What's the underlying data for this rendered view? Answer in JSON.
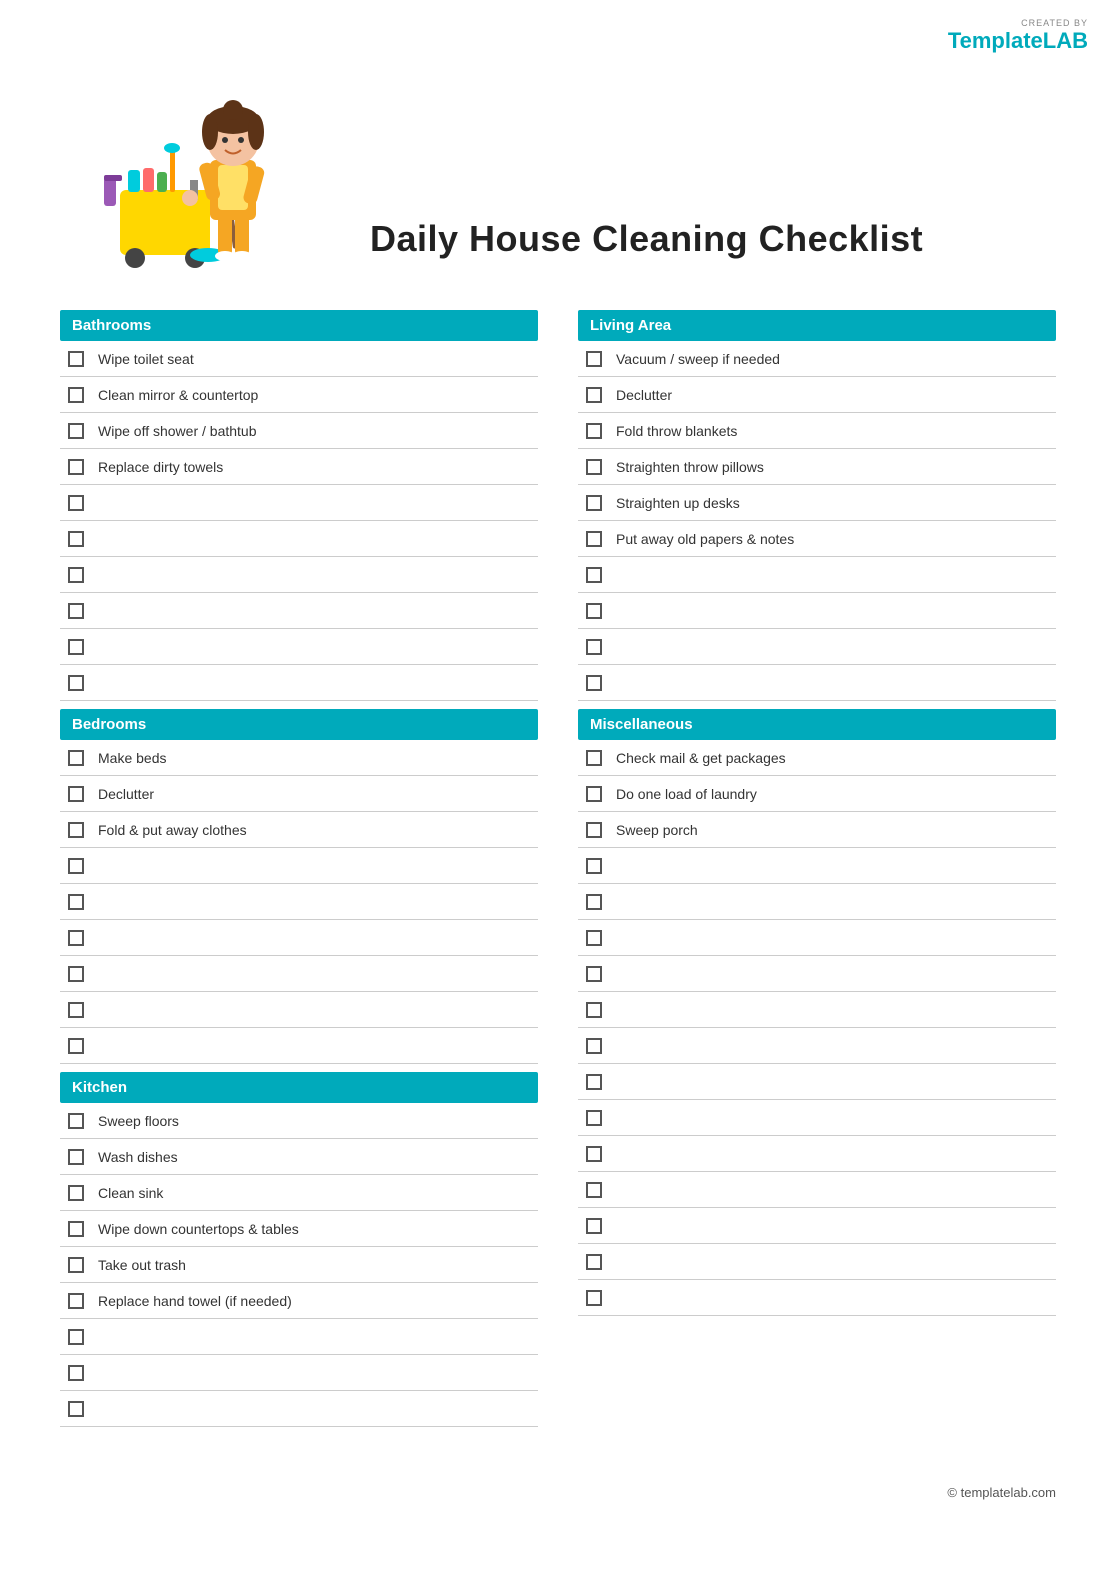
{
  "logo": {
    "created_by": "CREATED BY",
    "template": "Template",
    "lab": "LAB"
  },
  "title": "Daily House Cleaning Checklist",
  "sections": {
    "bathrooms": {
      "label": "Bathrooms",
      "items": [
        "Wipe toilet seat",
        "Clean mirror & countertop",
        "Wipe off shower / bathtub",
        "Replace dirty towels",
        "",
        "",
        "",
        "",
        "",
        ""
      ]
    },
    "bedrooms": {
      "label": "Bedrooms",
      "items": [
        "Make beds",
        "Declutter",
        "Fold & put away clothes",
        "",
        "",
        "",
        "",
        "",
        ""
      ]
    },
    "kitchen": {
      "label": "Kitchen",
      "items": [
        "Sweep floors",
        "Wash dishes",
        "Clean sink",
        "Wipe down countertops & tables",
        "Take out trash",
        "Replace hand towel (if needed)",
        "",
        "",
        ""
      ]
    },
    "living_area": {
      "label": "Living Area",
      "items": [
        "Vacuum / sweep if needed",
        "Declutter",
        "Fold throw blankets",
        "Straighten throw pillows",
        "Straighten up desks",
        "Put away old papers & notes",
        "",
        "",
        "",
        ""
      ]
    },
    "miscellaneous": {
      "label": "Miscellaneous",
      "items": [
        "Check mail & get packages",
        "Do one load of laundry",
        "Sweep porch",
        "",
        "",
        "",
        "",
        "",
        "",
        "",
        "",
        "",
        "",
        ""
      ]
    }
  },
  "footer": {
    "copyright": "© templatelab.com"
  }
}
